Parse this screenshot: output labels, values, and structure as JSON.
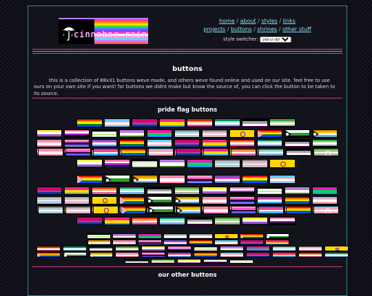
{
  "logo": {
    "text": "cinnabar rain",
    "stripe_colors": [
      "#ff3c8c",
      "#ff8a00",
      "#ffe000",
      "#3cdc3c",
      "#3c8cff",
      "#8c3cff",
      "#ff3cc8",
      "#ffffff",
      "#ff9bd2",
      "#7ad0ff",
      "#c080ff",
      "#ff5a5a"
    ]
  },
  "nav": {
    "row1": [
      {
        "label": "home"
      },
      {
        "label": "about"
      },
      {
        "label": "styles"
      },
      {
        "label": "links"
      }
    ],
    "row2": [
      {
        "label": "projects"
      },
      {
        "label": "buttons"
      },
      {
        "label": "shrines"
      },
      {
        "label": "other stuff"
      }
    ],
    "style_switcher_label": "style switcher:",
    "style_switcher_value": "pick ur style..."
  },
  "rule_colors": [
    "#d04080",
    "#e0a020",
    "#40a0a0"
  ],
  "page_title": "buttons",
  "intro": "this is a collection of 88x31 buttons weve made, and others weve found online and used on our site. feel free to use ours on your own site if you want! for buttons we didnt make but know the source of, you can click the button to be taken to its source.",
  "section_pride": "pride flag buttons",
  "section_other": "our other buttons",
  "palettes": {
    "rainbow": [
      "#e40303",
      "#ff8c00",
      "#ffed00",
      "#008026",
      "#004dff",
      "#750787"
    ],
    "trans": [
      "#5bcefa",
      "#f5a9b8",
      "#ffffff",
      "#f5a9b8",
      "#5bcefa"
    ],
    "bi": [
      "#d60270",
      "#d60270",
      "#9b4f96",
      "#0038a8",
      "#0038a8"
    ],
    "pan": [
      "#ff218c",
      "#ffd800",
      "#21b1ff"
    ],
    "lesbian": [
      "#d52d00",
      "#ff9a56",
      "#ffffff",
      "#d362a4",
      "#a30262"
    ],
    "gay": [
      "#078d70",
      "#98e8c1",
      "#ffffff",
      "#7bade2",
      "#3d1a78"
    ],
    "ace": [
      "#000000",
      "#a3a3a3",
      "#ffffff",
      "#800080"
    ],
    "aro": [
      "#3da542",
      "#a7d379",
      "#ffffff",
      "#a9a9a9",
      "#000000"
    ],
    "nb": [
      "#fcf434",
      "#ffffff",
      "#9c59d1",
      "#2c2c2c"
    ],
    "genderfluid": [
      "#ff76a4",
      "#ffffff",
      "#c011d7",
      "#000000",
      "#2f3cbe"
    ],
    "agender": [
      "#000000",
      "#bcc4c7",
      "#ffffff",
      "#b7f684",
      "#ffffff",
      "#bcc4c7",
      "#000000"
    ],
    "genderqueer": [
      "#b57edc",
      "#ffffff",
      "#4a8123"
    ],
    "polysexual": [
      "#f714ba",
      "#01d66a",
      "#1594f6"
    ],
    "demiboy": [
      "#7f7f7f",
      "#c4c4c4",
      "#9ad9eb",
      "#ffffff",
      "#9ad9eb",
      "#c4c4c4",
      "#7f7f7f"
    ],
    "demigirl": [
      "#7f7f7f",
      "#c4c4c4",
      "#fdadc8",
      "#ffffff",
      "#fdadc8",
      "#c4c4c4",
      "#7f7f7f"
    ],
    "intersex": [
      "#ffd800"
    ],
    "progress": [
      "#e40303",
      "#ff8c00",
      "#ffed00",
      "#008026",
      "#004dff",
      "#750787"
    ],
    "neutrois": [
      "#ffffff",
      "#2f9c2f",
      "#000000"
    ],
    "aroace": [
      "#e28c00",
      "#eccd00",
      "#ffffff",
      "#62aedc",
      "#203856"
    ],
    "sapphic": [
      "#fd8ba8",
      "#fbf2ff",
      "#fd8ba8"
    ],
    "omni": [
      "#fe9ace",
      "#ff53bf",
      "#200044",
      "#6760fe",
      "#8ea6ff"
    ],
    "multisexual": [
      "#724dc9",
      "#ff3d9b",
      "#ffffff",
      "#3db7ff",
      "#6b3aa6"
    ]
  }
}
